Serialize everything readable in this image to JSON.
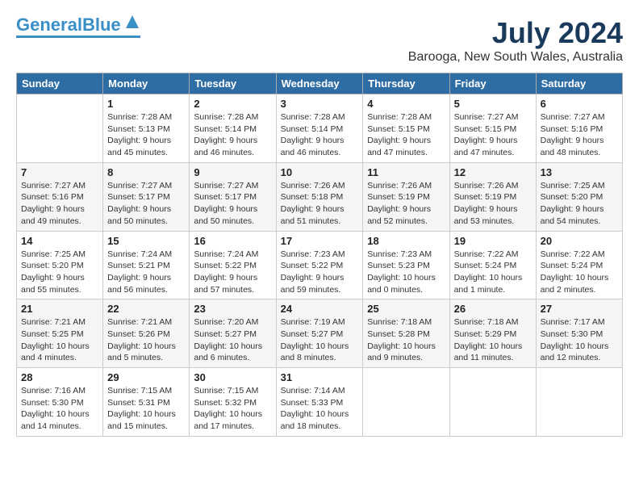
{
  "header": {
    "logo": {
      "line1": "General",
      "line2": "Blue"
    },
    "title": "July 2024",
    "subtitle": "Barooga, New South Wales, Australia"
  },
  "days": [
    "Sunday",
    "Monday",
    "Tuesday",
    "Wednesday",
    "Thursday",
    "Friday",
    "Saturday"
  ],
  "weeks": [
    [
      {
        "num": "",
        "empty": true
      },
      {
        "num": "1",
        "sunrise": "7:28 AM",
        "sunset": "5:13 PM",
        "daylight": "9 hours and 45 minutes."
      },
      {
        "num": "2",
        "sunrise": "7:28 AM",
        "sunset": "5:14 PM",
        "daylight": "9 hours and 46 minutes."
      },
      {
        "num": "3",
        "sunrise": "7:28 AM",
        "sunset": "5:14 PM",
        "daylight": "9 hours and 46 minutes."
      },
      {
        "num": "4",
        "sunrise": "7:28 AM",
        "sunset": "5:15 PM",
        "daylight": "9 hours and 47 minutes."
      },
      {
        "num": "5",
        "sunrise": "7:27 AM",
        "sunset": "5:15 PM",
        "daylight": "9 hours and 47 minutes."
      },
      {
        "num": "6",
        "sunrise": "7:27 AM",
        "sunset": "5:16 PM",
        "daylight": "9 hours and 48 minutes."
      }
    ],
    [
      {
        "num": "7",
        "sunrise": "7:27 AM",
        "sunset": "5:16 PM",
        "daylight": "9 hours and 49 minutes."
      },
      {
        "num": "8",
        "sunrise": "7:27 AM",
        "sunset": "5:17 PM",
        "daylight": "9 hours and 50 minutes."
      },
      {
        "num": "9",
        "sunrise": "7:27 AM",
        "sunset": "5:17 PM",
        "daylight": "9 hours and 50 minutes."
      },
      {
        "num": "10",
        "sunrise": "7:26 AM",
        "sunset": "5:18 PM",
        "daylight": "9 hours and 51 minutes."
      },
      {
        "num": "11",
        "sunrise": "7:26 AM",
        "sunset": "5:19 PM",
        "daylight": "9 hours and 52 minutes."
      },
      {
        "num": "12",
        "sunrise": "7:26 AM",
        "sunset": "5:19 PM",
        "daylight": "9 hours and 53 minutes."
      },
      {
        "num": "13",
        "sunrise": "7:25 AM",
        "sunset": "5:20 PM",
        "daylight": "9 hours and 54 minutes."
      }
    ],
    [
      {
        "num": "14",
        "sunrise": "7:25 AM",
        "sunset": "5:20 PM",
        "daylight": "9 hours and 55 minutes."
      },
      {
        "num": "15",
        "sunrise": "7:24 AM",
        "sunset": "5:21 PM",
        "daylight": "9 hours and 56 minutes."
      },
      {
        "num": "16",
        "sunrise": "7:24 AM",
        "sunset": "5:22 PM",
        "daylight": "9 hours and 57 minutes."
      },
      {
        "num": "17",
        "sunrise": "7:23 AM",
        "sunset": "5:22 PM",
        "daylight": "9 hours and 59 minutes."
      },
      {
        "num": "18",
        "sunrise": "7:23 AM",
        "sunset": "5:23 PM",
        "daylight": "10 hours and 0 minutes."
      },
      {
        "num": "19",
        "sunrise": "7:22 AM",
        "sunset": "5:24 PM",
        "daylight": "10 hours and 1 minute."
      },
      {
        "num": "20",
        "sunrise": "7:22 AM",
        "sunset": "5:24 PM",
        "daylight": "10 hours and 2 minutes."
      }
    ],
    [
      {
        "num": "21",
        "sunrise": "7:21 AM",
        "sunset": "5:25 PM",
        "daylight": "10 hours and 4 minutes."
      },
      {
        "num": "22",
        "sunrise": "7:21 AM",
        "sunset": "5:26 PM",
        "daylight": "10 hours and 5 minutes."
      },
      {
        "num": "23",
        "sunrise": "7:20 AM",
        "sunset": "5:27 PM",
        "daylight": "10 hours and 6 minutes."
      },
      {
        "num": "24",
        "sunrise": "7:19 AM",
        "sunset": "5:27 PM",
        "daylight": "10 hours and 8 minutes."
      },
      {
        "num": "25",
        "sunrise": "7:18 AM",
        "sunset": "5:28 PM",
        "daylight": "10 hours and 9 minutes."
      },
      {
        "num": "26",
        "sunrise": "7:18 AM",
        "sunset": "5:29 PM",
        "daylight": "10 hours and 11 minutes."
      },
      {
        "num": "27",
        "sunrise": "7:17 AM",
        "sunset": "5:30 PM",
        "daylight": "10 hours and 12 minutes."
      }
    ],
    [
      {
        "num": "28",
        "sunrise": "7:16 AM",
        "sunset": "5:30 PM",
        "daylight": "10 hours and 14 minutes."
      },
      {
        "num": "29",
        "sunrise": "7:15 AM",
        "sunset": "5:31 PM",
        "daylight": "10 hours and 15 minutes."
      },
      {
        "num": "30",
        "sunrise": "7:15 AM",
        "sunset": "5:32 PM",
        "daylight": "10 hours and 17 minutes."
      },
      {
        "num": "31",
        "sunrise": "7:14 AM",
        "sunset": "5:33 PM",
        "daylight": "10 hours and 18 minutes."
      },
      {
        "num": "",
        "empty": true
      },
      {
        "num": "",
        "empty": true
      },
      {
        "num": "",
        "empty": true
      }
    ]
  ],
  "labels": {
    "sunrise": "Sunrise:",
    "sunset": "Sunset:",
    "daylight": "Daylight:"
  }
}
